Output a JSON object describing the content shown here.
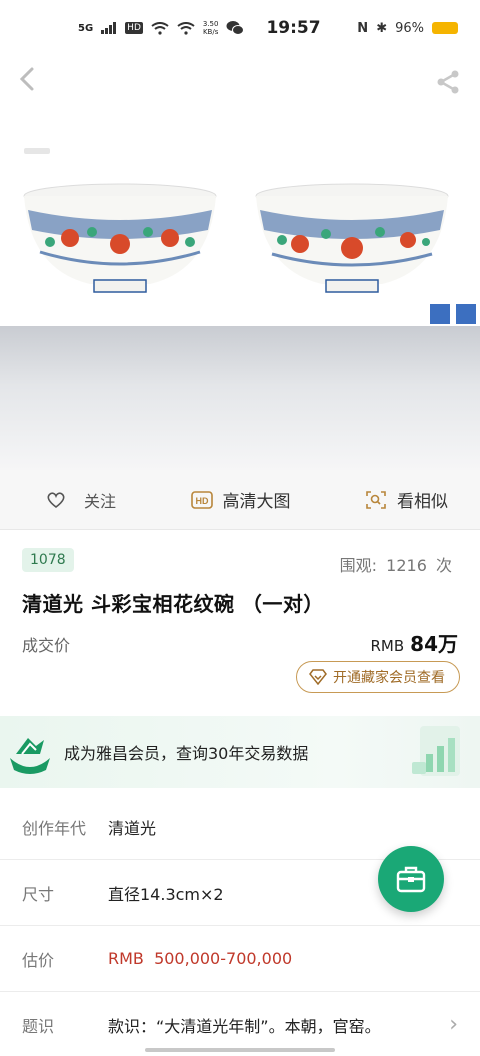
{
  "status_bar": {
    "network": "5G",
    "hd": "HD",
    "speed_value": "3.50",
    "speed_unit": "KB/s",
    "time": "19:57",
    "battery": "96%"
  },
  "icons": {
    "back": "chevron-left-icon",
    "share": "share-icon",
    "follow": "heart-icon",
    "hd": "hd-icon",
    "similar": "image-search-icon",
    "vip": "diamond-icon",
    "fab": "briefcase-icon"
  },
  "actions": {
    "follow_label": "关注",
    "hd_label": "高清大图",
    "similar_label": "看相似"
  },
  "lot": {
    "number": "1078",
    "views_label": "围观:",
    "views_count": "1216",
    "views_unit": "次",
    "title": "清道光 斗彩宝相花纹碗 （一对）",
    "price_label": "成交价",
    "currency": "RMB",
    "price": "84万",
    "vip_button": "开通藏家会员查看"
  },
  "member_banner": {
    "text": "成为雅昌会员，查询30年交易数据"
  },
  "details": [
    {
      "label": "创作年代",
      "value": "清道光"
    },
    {
      "label": "尺寸",
      "value": "直径14.3cm×2"
    },
    {
      "label": "估价",
      "value": "RMB  500,000-700,000"
    },
    {
      "label": "题识",
      "value": "款识：“大清道光年制”。本朝，官窑。"
    }
  ],
  "colors": {
    "accent_green": "#1aa876",
    "estimate_red": "#c0392b",
    "vip_gold": "#a06c28"
  }
}
